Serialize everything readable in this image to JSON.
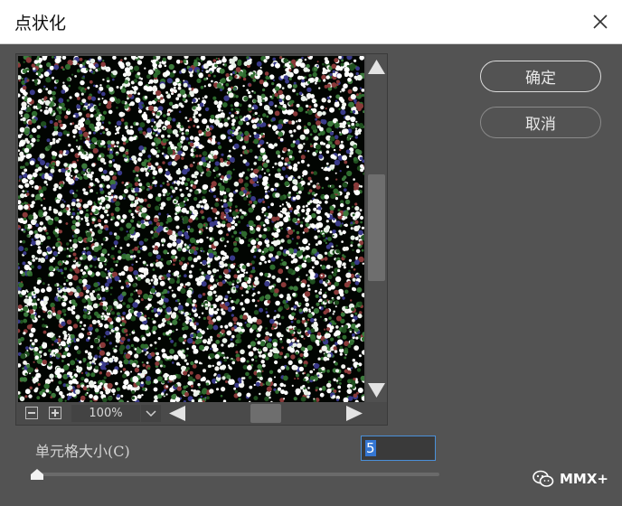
{
  "dialog": {
    "title": "点状化",
    "ok_label": "确定",
    "cancel_label": "取消"
  },
  "preview": {
    "zoom": "100%"
  },
  "params": {
    "cell_size_label": "单元格大小(C)",
    "cell_size_value": "5",
    "cell_size_slider_fraction": 0.0
  },
  "watermark": {
    "text": "MMX+"
  },
  "colors": {
    "dialog_bg": "#535353",
    "input_highlight": "#3476d2"
  }
}
